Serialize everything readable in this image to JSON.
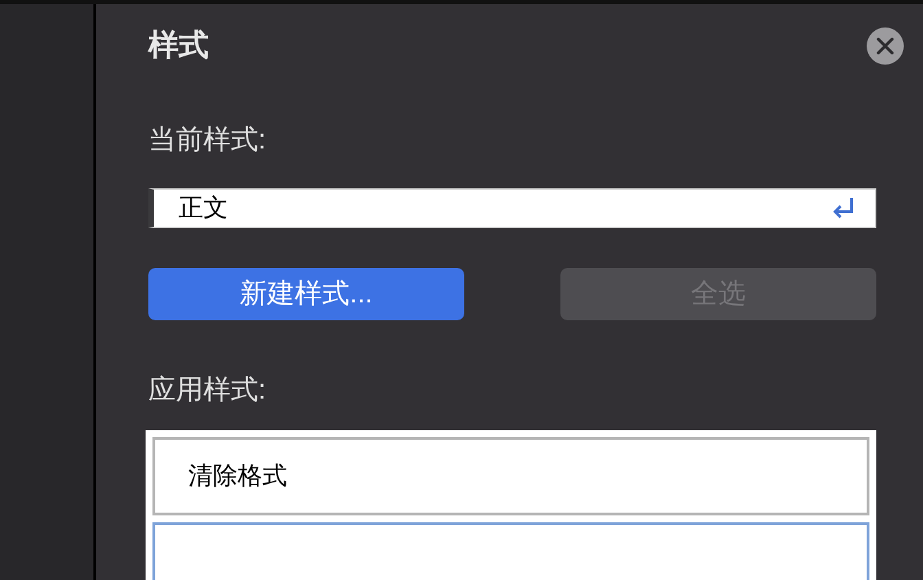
{
  "panel": {
    "title": "样式"
  },
  "current_style": {
    "label": "当前样式:",
    "value": "正文"
  },
  "buttons": [
    {
      "label": "新建样式...",
      "kind": "primary",
      "disabled": false
    },
    {
      "label": "全选",
      "kind": "secondary",
      "disabled": true
    }
  ],
  "apply_styles": {
    "label": "应用样式:",
    "items": [
      {
        "label": "清除格式",
        "selected": false
      },
      {
        "selected": true
      }
    ]
  }
}
